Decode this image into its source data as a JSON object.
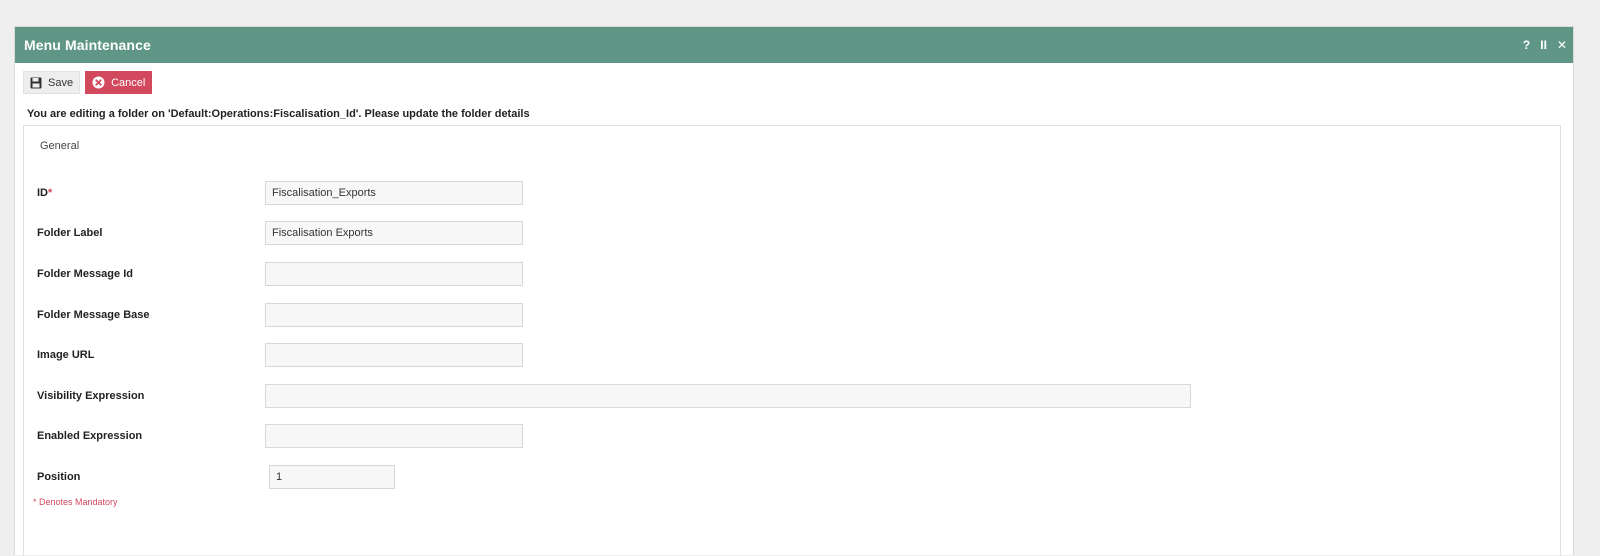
{
  "window": {
    "title": "Menu Maintenance",
    "icons": {
      "help": "?",
      "pause": "II",
      "close": "✕"
    }
  },
  "toolbar": {
    "save_label": "Save",
    "cancel_label": "Cancel"
  },
  "message": "You are editing a folder on 'Default:Operations:Fiscalisation_Id'. Please update the folder details",
  "section": {
    "title": "General"
  },
  "fields": {
    "id": {
      "label": "ID",
      "required_mark": "*",
      "value": "Fiscalisation_Exports"
    },
    "folder_label": {
      "label": "Folder Label",
      "value": "Fiscalisation Exports"
    },
    "folder_message_id": {
      "label": "Folder Message Id",
      "value": ""
    },
    "folder_message_base": {
      "label": "Folder Message Base",
      "value": ""
    },
    "image_url": {
      "label": "Image URL",
      "value": ""
    },
    "visibility_expression": {
      "label": "Visibility Expression",
      "value": ""
    },
    "enabled_expression": {
      "label": "Enabled Expression",
      "value": ""
    },
    "position": {
      "label": "Position",
      "value": "1"
    }
  },
  "mandatory_note": "* Denotes Mandatory",
  "colors": {
    "titlebar": "#5f9686",
    "cancel": "#d2485d",
    "required": "#d2485d"
  }
}
